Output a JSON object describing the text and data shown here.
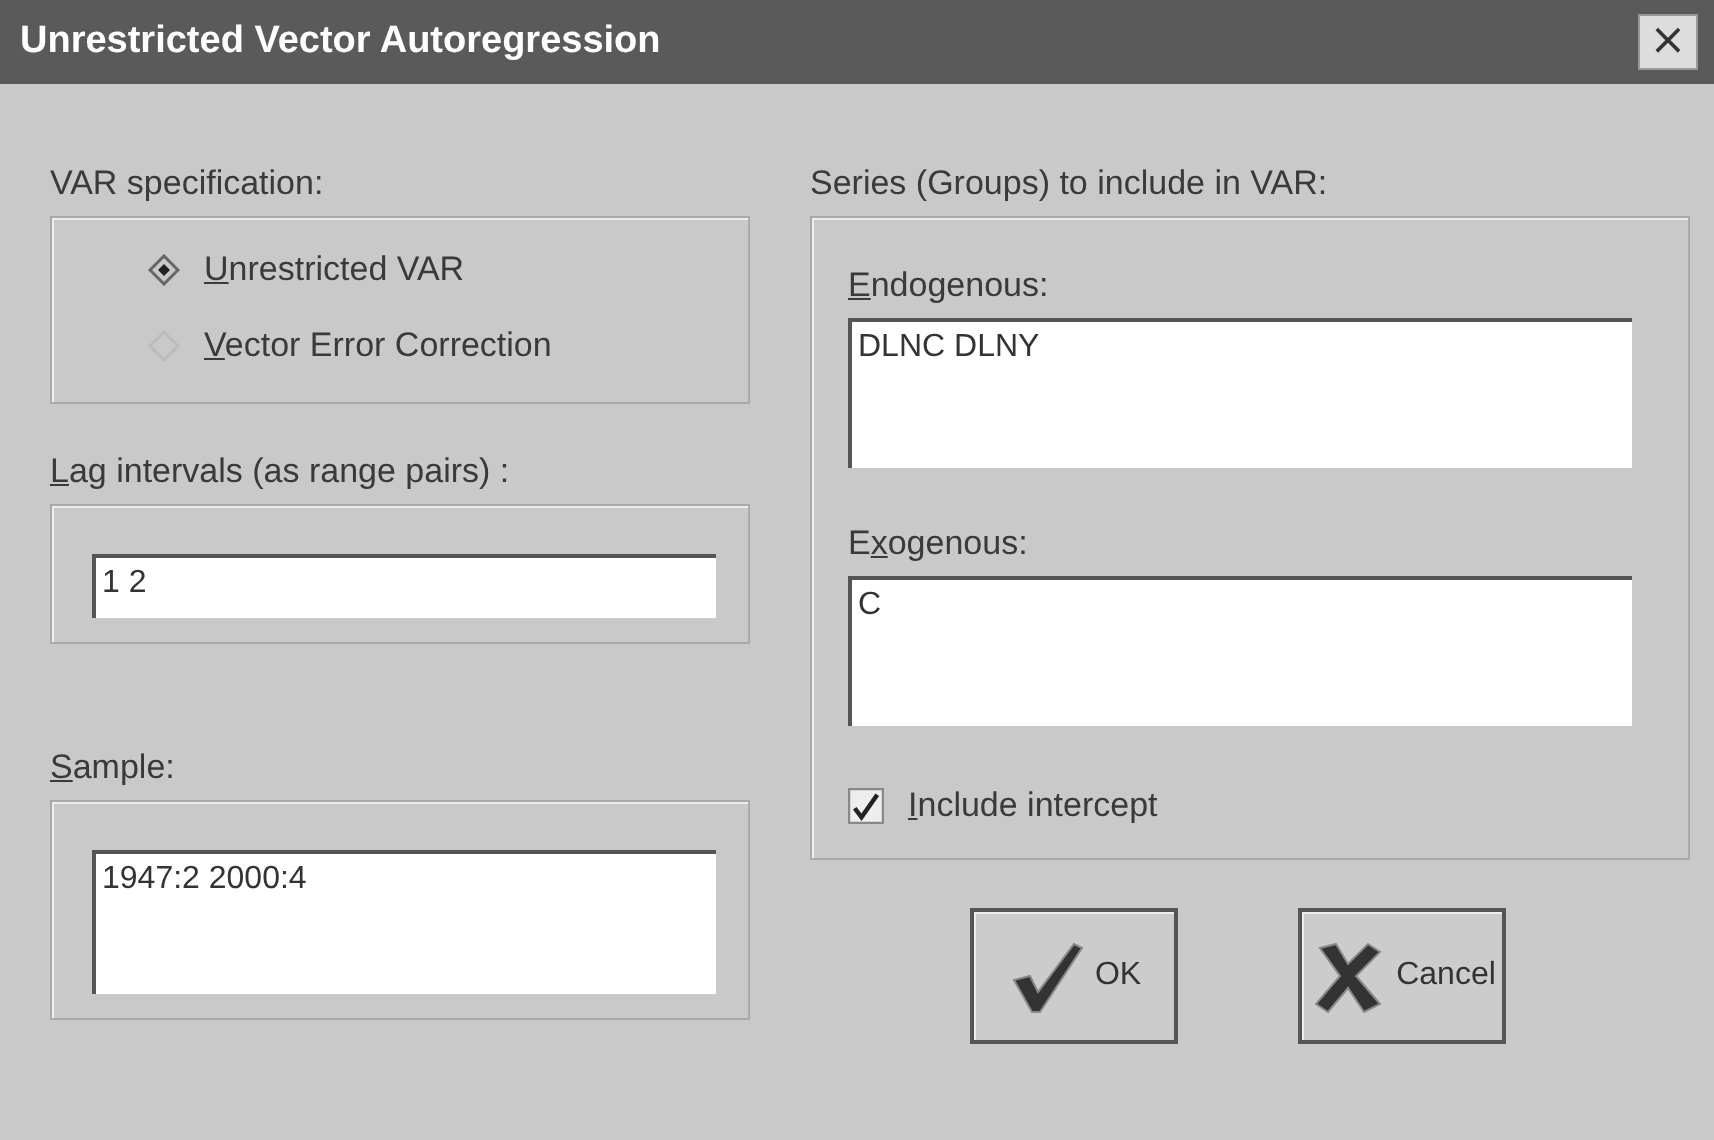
{
  "window": {
    "title": "Unrestricted Vector Autoregression",
    "close": "×"
  },
  "var_specification": {
    "label": "VAR specification:",
    "options": [
      {
        "label": {
          "key": "U",
          "after": "nrestricted VAR"
        },
        "selected": true
      },
      {
        "label": {
          "key": "V",
          "after": "ector Error Correction"
        },
        "selected": false
      }
    ]
  },
  "lag_intervals": {
    "label": {
      "key": "L",
      "after": "ag intervals (as range pairs) :"
    },
    "value": "1 2"
  },
  "sample": {
    "label": {
      "key": "S",
      "after": "ample:"
    },
    "value": "1947:2 2000:4"
  },
  "series": {
    "label": "Series (Groups) to include in VAR:",
    "endogenous": {
      "label": {
        "key": "E",
        "after": "ndogenous:"
      },
      "value": "DLNC DLNY"
    },
    "exogenous": {
      "label": {
        "before": "E",
        "key": "x",
        "after": "ogenous:"
      },
      "value": "C"
    },
    "include_intercept": {
      "label": {
        "key": "I",
        "after": "nclude intercept"
      },
      "checked": true
    }
  },
  "buttons": [
    {
      "kind": "ok",
      "label": "OK"
    },
    {
      "kind": "cancel",
      "label": "Cancel"
    }
  ]
}
